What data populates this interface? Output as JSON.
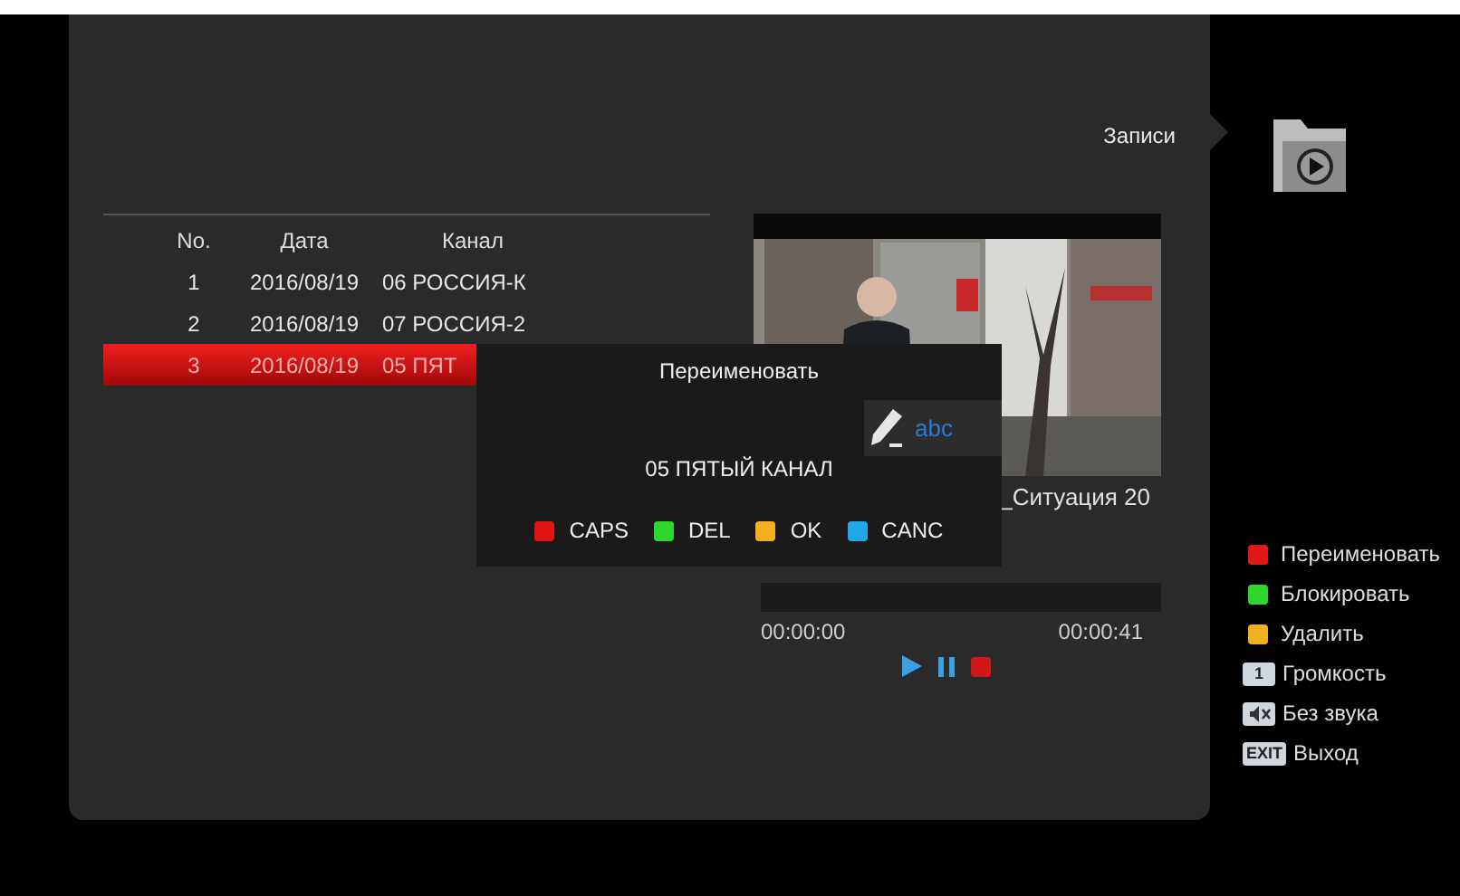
{
  "menu": {
    "title": "Записи"
  },
  "table": {
    "columns": [
      "No.",
      "Дата",
      "Канал"
    ],
    "rows": [
      {
        "cells": [
          "1",
          "2016/08/19",
          "06 РОССИЯ-К"
        ],
        "selected": false
      },
      {
        "cells": [
          "2",
          "2016/08/19",
          "07 РОССИЯ-2"
        ],
        "selected": false
      },
      {
        "cells": [
          "3",
          "2016/08/19",
          "05 ПЯТ"
        ],
        "selected": true
      }
    ]
  },
  "preview": {
    "kind": "picture",
    "caption": "_Ситуация 20",
    "progress": {
      "level": 0
    },
    "time_start": "00:00:00",
    "time_end": "00:00:41"
  },
  "dialog": {
    "title": "Переименовать",
    "mode": "abc",
    "value": "05 ПЯТЫЙ КАНАЛ",
    "keys": [
      {
        "color": "#e01414",
        "label": "CAPS"
      },
      {
        "color": "#2ed62e",
        "label": "DEL"
      },
      {
        "color": "#f0b020",
        "label": "OK"
      },
      {
        "color": "#22a8e8",
        "label": "CANC"
      }
    ]
  },
  "legend": [
    {
      "kind": "color",
      "color": "#e01818",
      "label": "Переименовать"
    },
    {
      "kind": "color",
      "color": "#2ed62e",
      "label": "Блокировать"
    },
    {
      "kind": "color",
      "color": "#f0b020",
      "label": "Удалить"
    },
    {
      "kind": "key",
      "key": "1",
      "label": "Громкость"
    },
    {
      "kind": "mute",
      "label": "Без звука"
    },
    {
      "kind": "key",
      "key": "EXIT",
      "label": "Выход"
    }
  ]
}
